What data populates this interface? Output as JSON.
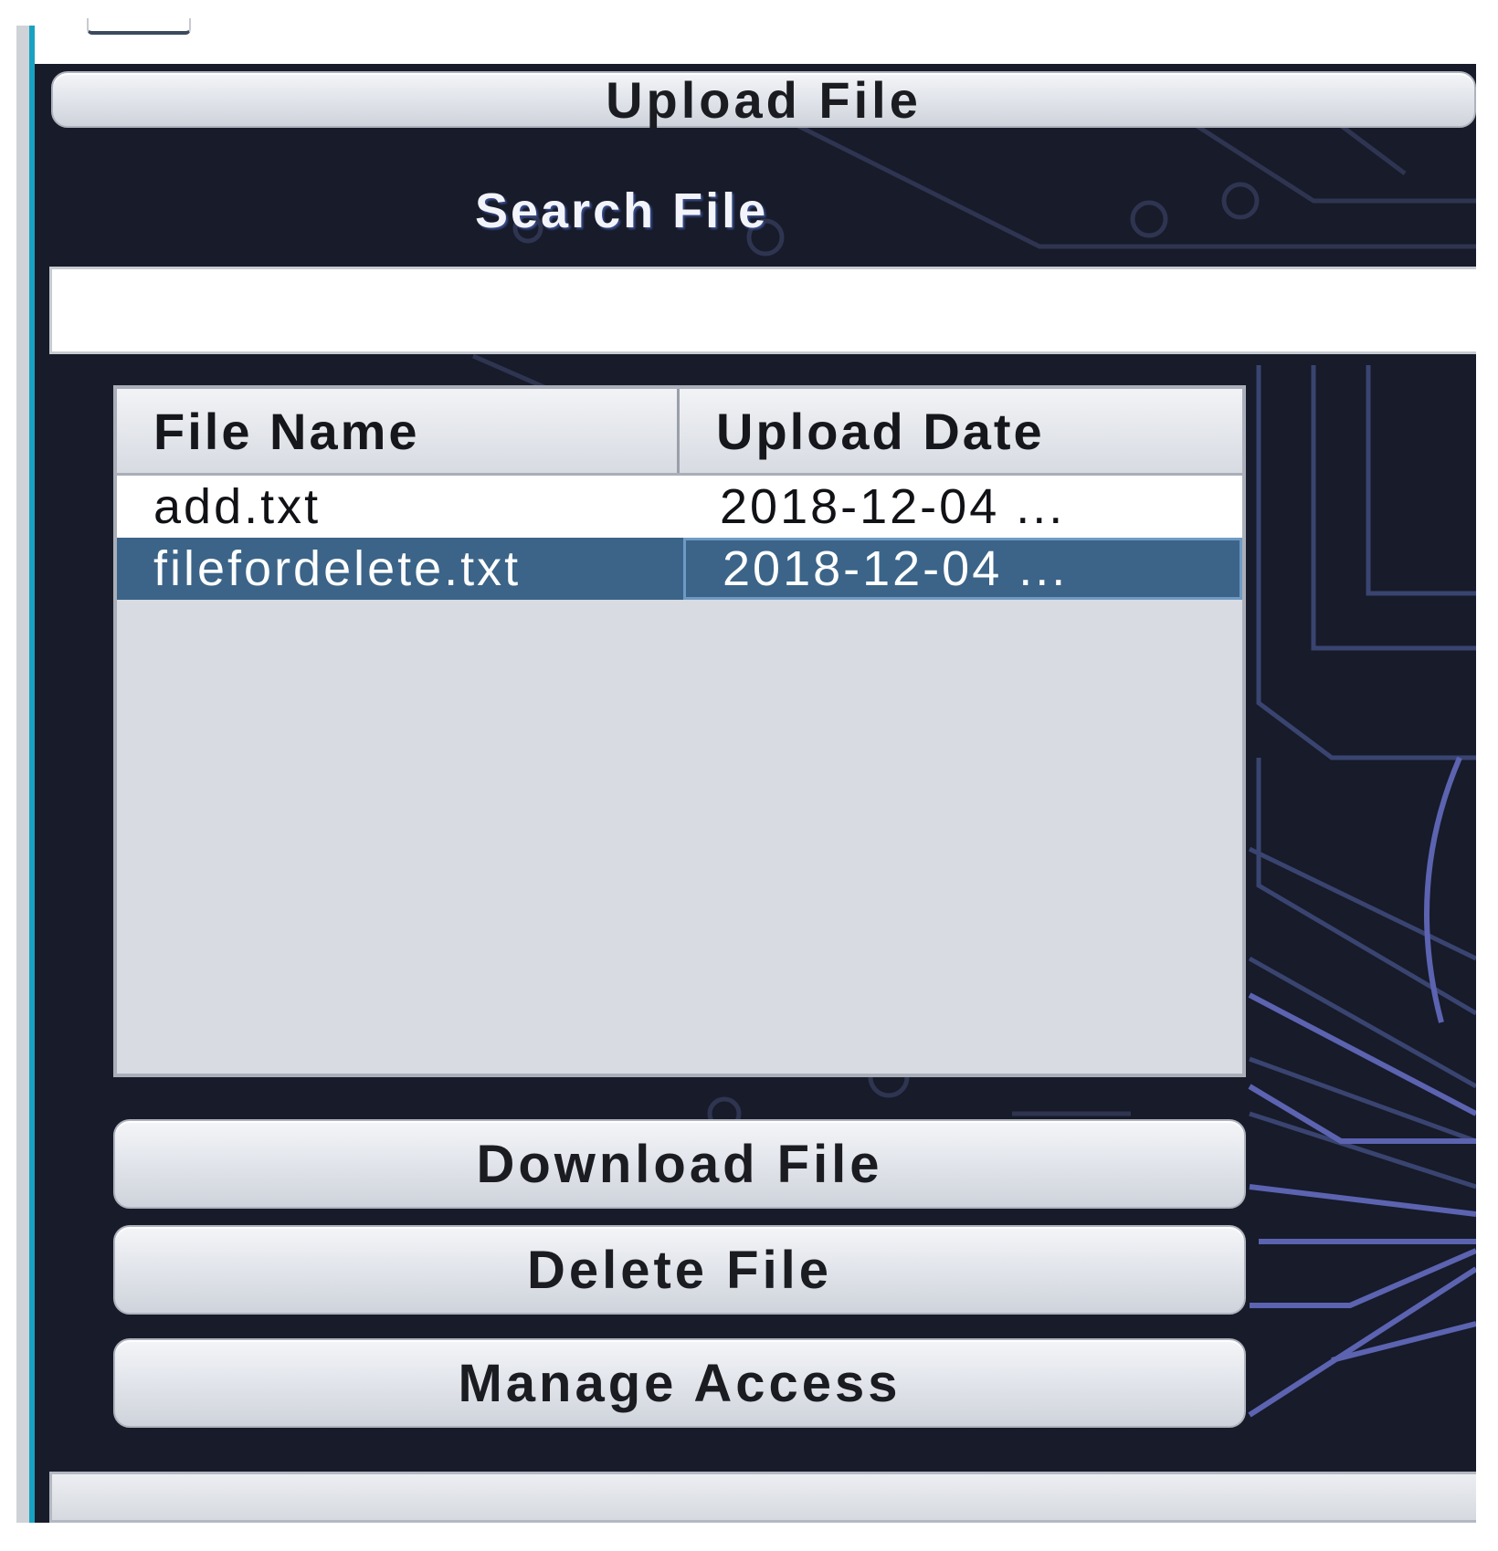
{
  "toolbar": {
    "upload_label": "Upload File"
  },
  "search": {
    "label": "Search File",
    "value": "",
    "placeholder": ""
  },
  "table": {
    "columns": [
      "File Name",
      "Upload Date"
    ],
    "rows": [
      {
        "name": "add.txt",
        "date": "2018-12-04 ...",
        "selected": false
      },
      {
        "name": "filefordelete.txt",
        "date": "2018-12-04 ...",
        "selected": true
      }
    ]
  },
  "actions": {
    "download_label": "Download File",
    "delete_label": "Delete File",
    "manage_label": "Manage Access"
  },
  "colors": {
    "panel_background": "#171b2a",
    "selection": "#3b6488",
    "window_edge_accent": "#18a2c2"
  }
}
